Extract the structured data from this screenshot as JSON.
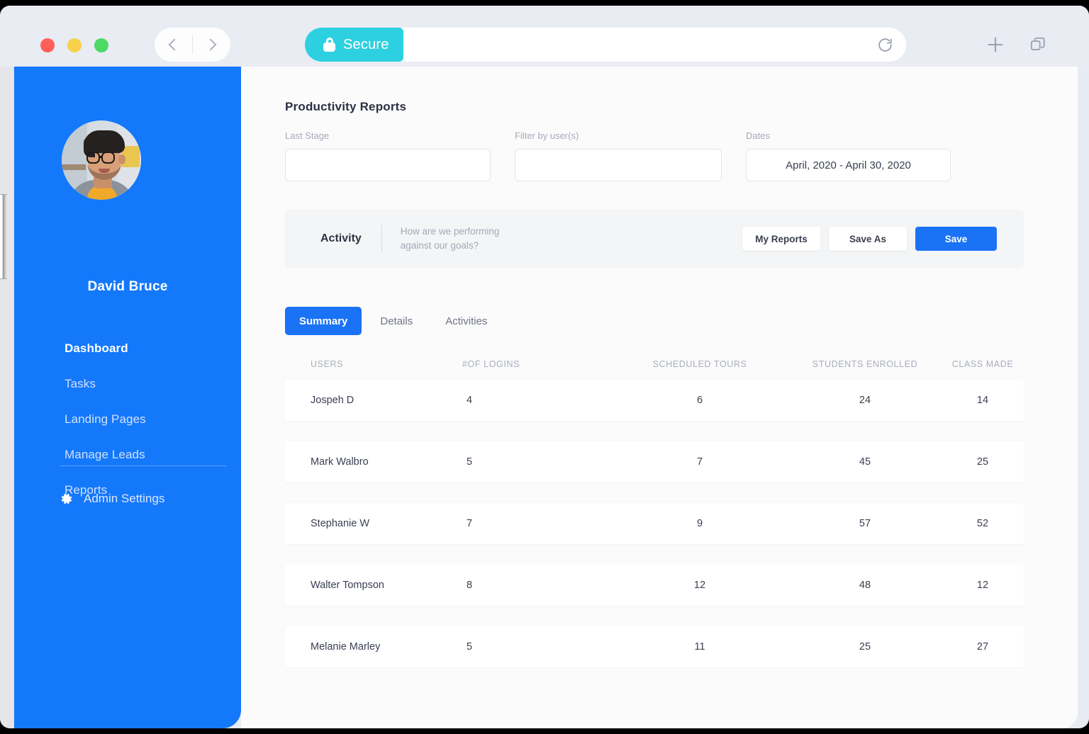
{
  "browser": {
    "secure_label": "Secure",
    "url_value": "",
    "url_placeholder": "",
    "icons": {
      "back": "chevron-left-icon",
      "forward": "chevron-right-icon",
      "lock": "lock-icon",
      "reload": "reload-icon",
      "new_tab": "plus-icon",
      "tabs": "copy-tabs-icon"
    }
  },
  "sidebar": {
    "username": "David Bruce",
    "avatar": "user-avatar-photo",
    "items": [
      {
        "label": "Dashboard",
        "active": true
      },
      {
        "label": "Tasks",
        "active": false
      },
      {
        "label": "Landing Pages",
        "active": false
      },
      {
        "label": "Manage Leads",
        "active": false
      },
      {
        "label": "Reports",
        "active": false
      }
    ],
    "admin_settings": {
      "label": "Admin Settings",
      "icon": "gear-icon"
    }
  },
  "main": {
    "title": "Productivity Reports",
    "filters": [
      {
        "label": "Last Stage",
        "value": "",
        "placeholder": ""
      },
      {
        "label": "Filter by user(s)",
        "value": "",
        "placeholder": ""
      },
      {
        "label": "Dates",
        "value": "April, 2020 - April 30, 2020",
        "placeholder": ""
      }
    ],
    "activity": {
      "title": "Activity",
      "subtitle_line1": "How are we performing",
      "subtitle_line2": "against our goals?",
      "buttons": {
        "my_reports": "My Reports",
        "save_as": "Save As",
        "save": "Save"
      }
    },
    "tabs": [
      {
        "label": "Summary",
        "active": true
      },
      {
        "label": "Details",
        "active": false
      },
      {
        "label": "Activities",
        "active": false
      }
    ],
    "table": {
      "columns": [
        "USERS",
        "#OF LOGINS",
        "SCHEDULED TOURS",
        "STUDENTS ENROLLED",
        "CLASS MADE"
      ],
      "rows": [
        {
          "user": "Jospeh D",
          "logins": "4",
          "tours": "6",
          "enrolled": "24",
          "class_made": "14"
        },
        {
          "user": "Mark Walbro",
          "logins": "5",
          "tours": "7",
          "enrolled": "45",
          "class_made": "25"
        },
        {
          "user": "Stephanie W",
          "logins": "7",
          "tours": "9",
          "enrolled": "57",
          "class_made": "52"
        },
        {
          "user": "Walter Tompson",
          "logins": "8",
          "tours": "12",
          "enrolled": "48",
          "class_made": "12"
        },
        {
          "user": "Melanie Marley",
          "logins": "5",
          "tours": "11",
          "enrolled": "25",
          "class_made": "27"
        }
      ]
    }
  },
  "colors": {
    "sidebar_blue": "#1478fb",
    "accent_blue": "#1a73f5",
    "secure_cyan": "#2dd0e0",
    "page_bg": "#fbfbfc",
    "chrome_bg": "#e9ecf3"
  }
}
